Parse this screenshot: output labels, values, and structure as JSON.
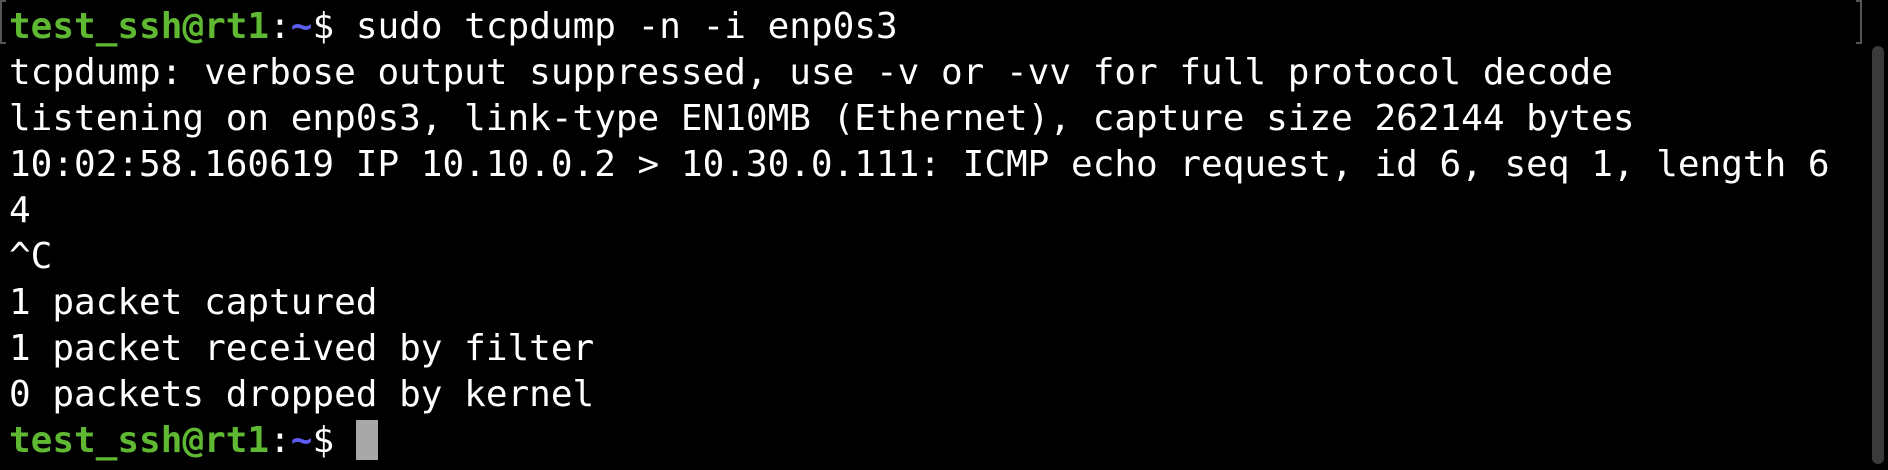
{
  "colors": {
    "background": "#000000",
    "text": "#ffffff",
    "prompt_user": "#5fb832",
    "prompt_path": "#5a5df0",
    "cursor": "#a8a8a8"
  },
  "prompt": {
    "user_host": "test_ssh@rt1",
    "colon": ":",
    "path": "~",
    "dollar": "$ "
  },
  "command_line": {
    "command": "sudo tcpdump -n -i enp0s3"
  },
  "output": [
    "tcpdump: verbose output suppressed, use -v or -vv for full protocol decode",
    "listening on enp0s3, link-type EN10MB (Ethernet), capture size 262144 bytes",
    "10:02:58.160619 IP 10.10.0.2 > 10.30.0.111: ICMP echo request, id 6, seq 1, length 6",
    "4",
    "^C",
    "1 packet captured",
    "1 packet received by filter",
    "0 packets dropped by kernel"
  ]
}
